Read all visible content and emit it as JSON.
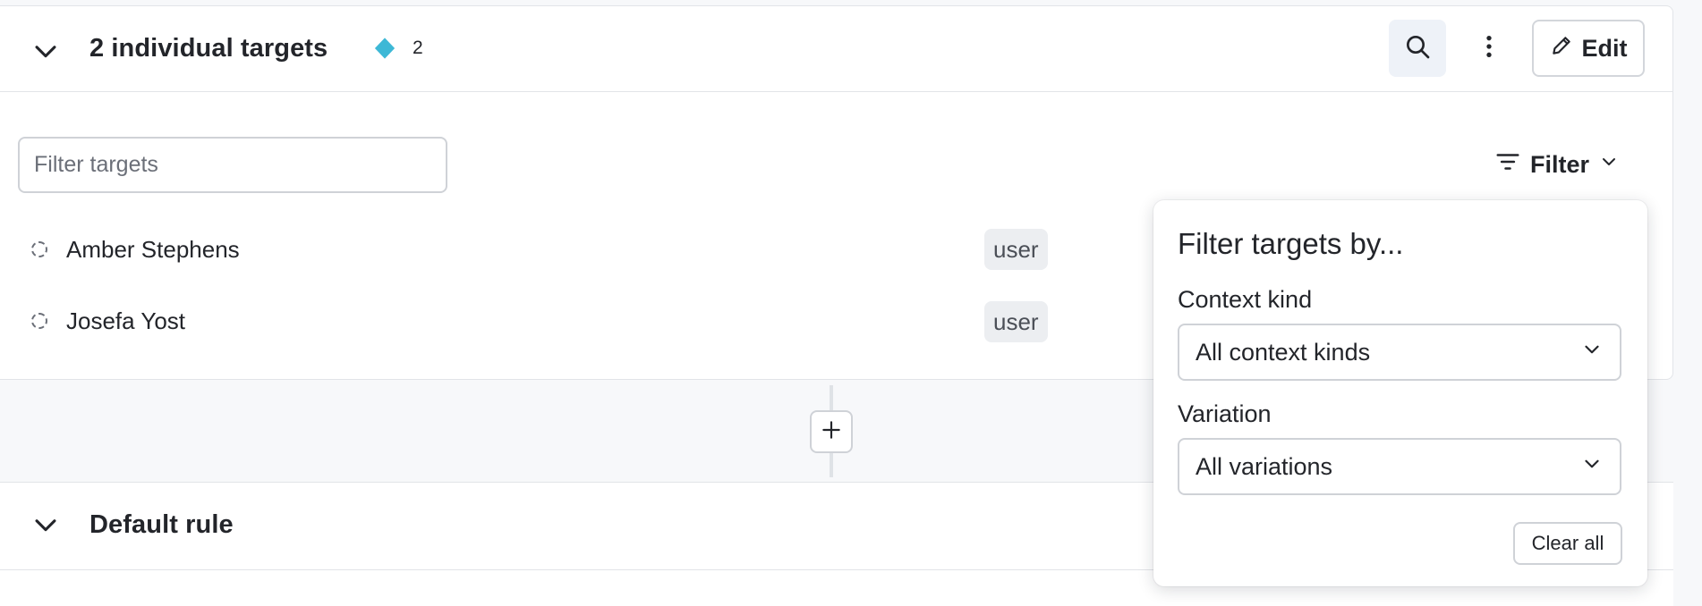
{
  "colors": {
    "accent_diamond": "#3db8d6",
    "border": "#e2e4e8",
    "page_bg": "#f7f8fa"
  },
  "targets_section": {
    "title": "2 individual targets",
    "variation_icon": "diamond-icon",
    "count": "2",
    "search_icon": "search-icon",
    "more_icon": "more-vertical-icon",
    "edit_label": "Edit",
    "edit_icon": "pencil-icon",
    "filter_input_placeholder": "Filter targets",
    "filter_label": "Filter",
    "filter_icon": "filter-lines-icon",
    "targets": [
      {
        "name": "Amber Stephens",
        "kind": "user"
      },
      {
        "name": "Josefa Yost",
        "kind": "user"
      }
    ]
  },
  "add_rule_icon": "plus-icon",
  "default_rule": {
    "title": "Default rule"
  },
  "filter_popover": {
    "title": "Filter targets by...",
    "context_kind_label": "Context kind",
    "context_kind_value": "All context kinds",
    "variation_label": "Variation",
    "variation_value": "All variations",
    "clear_label": "Clear all"
  }
}
